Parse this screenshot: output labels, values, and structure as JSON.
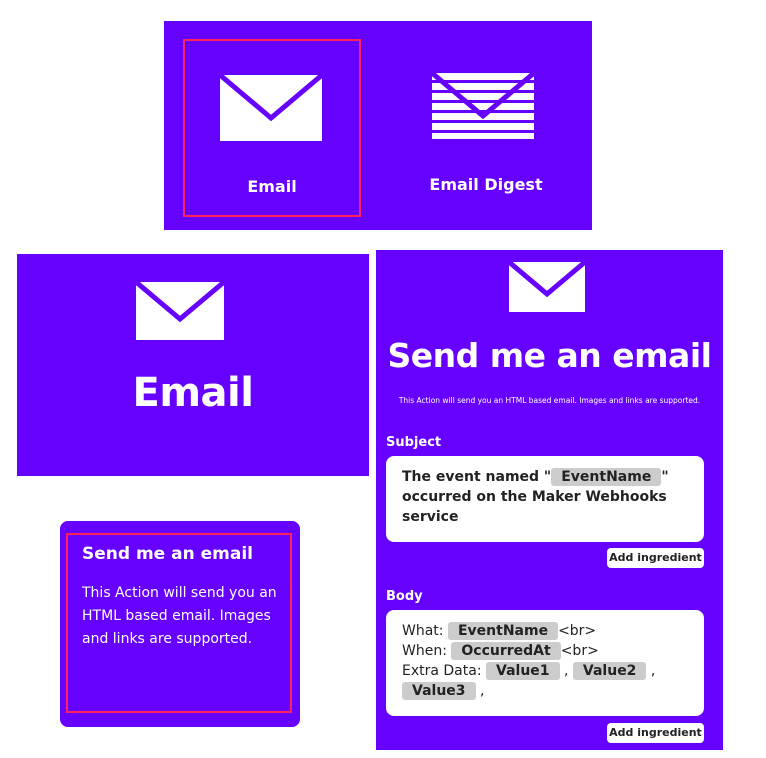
{
  "picker": {
    "tiles": [
      {
        "label": "Email",
        "icon": "envelope-icon",
        "selected": true
      },
      {
        "label": "Email Digest",
        "icon": "envelope-striped-icon",
        "selected": false
      }
    ]
  },
  "email_header": {
    "title": "Email",
    "icon": "envelope-icon"
  },
  "action_card": {
    "title": "Send me an email",
    "description": "This Action will send you an HTML based email. Images and links are supported."
  },
  "action_form": {
    "title": "Send me an email",
    "description": "This Action will send you an HTML based email. Images and links are supported.",
    "subject": {
      "label": "Subject",
      "text_1": "The event named \"",
      "chip_event": "EventName",
      "text_2": "\" occurred on the Maker Webhooks service",
      "add_ingredient": "Add ingredient"
    },
    "body": {
      "label": "Body",
      "line1_prefix": "What:",
      "chip_event": "EventName",
      "br": "<br>",
      "line2_prefix": "When:",
      "chip_occurred": "OccurredAt",
      "line3_prefix": "Extra Data:",
      "chip_value1": "Value1",
      "chip_value2": "Value2",
      "chip_value3": "Value3",
      "comma": ",",
      "add_ingredient": "Add ingredient"
    }
  },
  "colors": {
    "brand": "#6600ff",
    "highlight": "#ff1f5a",
    "chip": "#cccccc"
  }
}
